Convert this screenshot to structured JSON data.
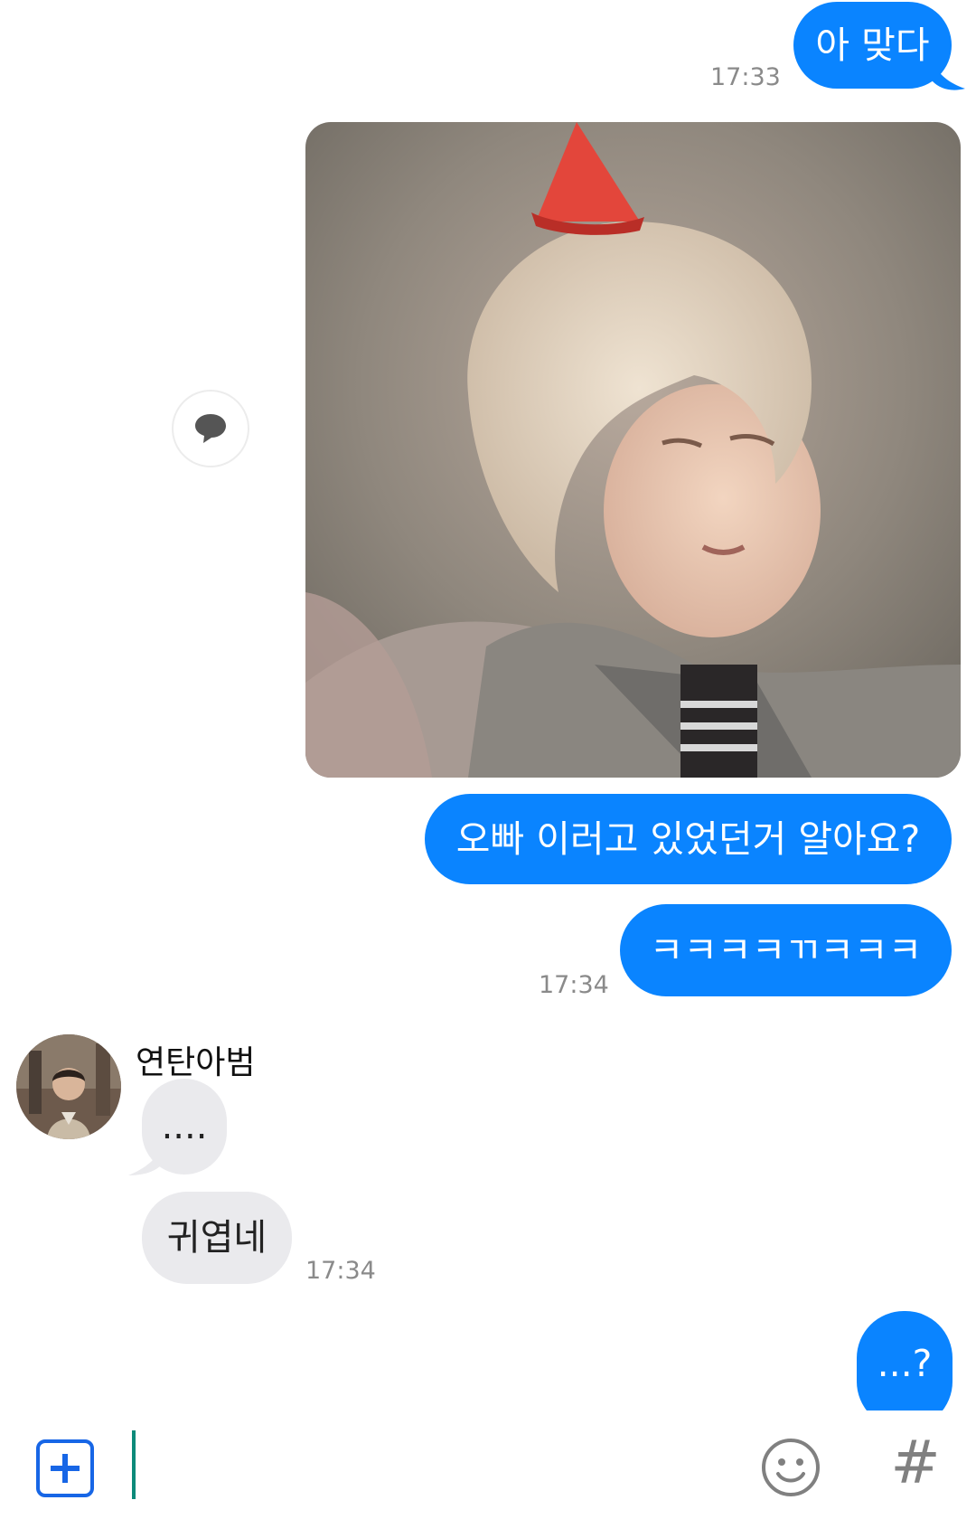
{
  "messages": {
    "m1": {
      "text": "아 맞다",
      "time": "17:33"
    },
    "m3": {
      "text": "오빠 이러고 있었던거 알아요?"
    },
    "m4": {
      "text": "ㅋㅋㅋㅋㄲㅋㅋㅋ",
      "time": "17:34"
    },
    "m5": {
      "sender": "연탄아범",
      "text": "...."
    },
    "m6": {
      "text": "귀엽네",
      "time": "17:34"
    },
    "m7": {
      "text": "...?"
    }
  },
  "icons": {
    "share": "chat-bubble-icon",
    "add": "plus-square-icon",
    "emoji": "smiley-icon",
    "hashtag": "#"
  },
  "colors": {
    "outgoing_bubble": "#0a84ff",
    "incoming_bubble": "#eaeaed",
    "timestamp": "#8a8a8a",
    "accent_plus": "#1766e6",
    "caret": "#0c8a7a"
  }
}
